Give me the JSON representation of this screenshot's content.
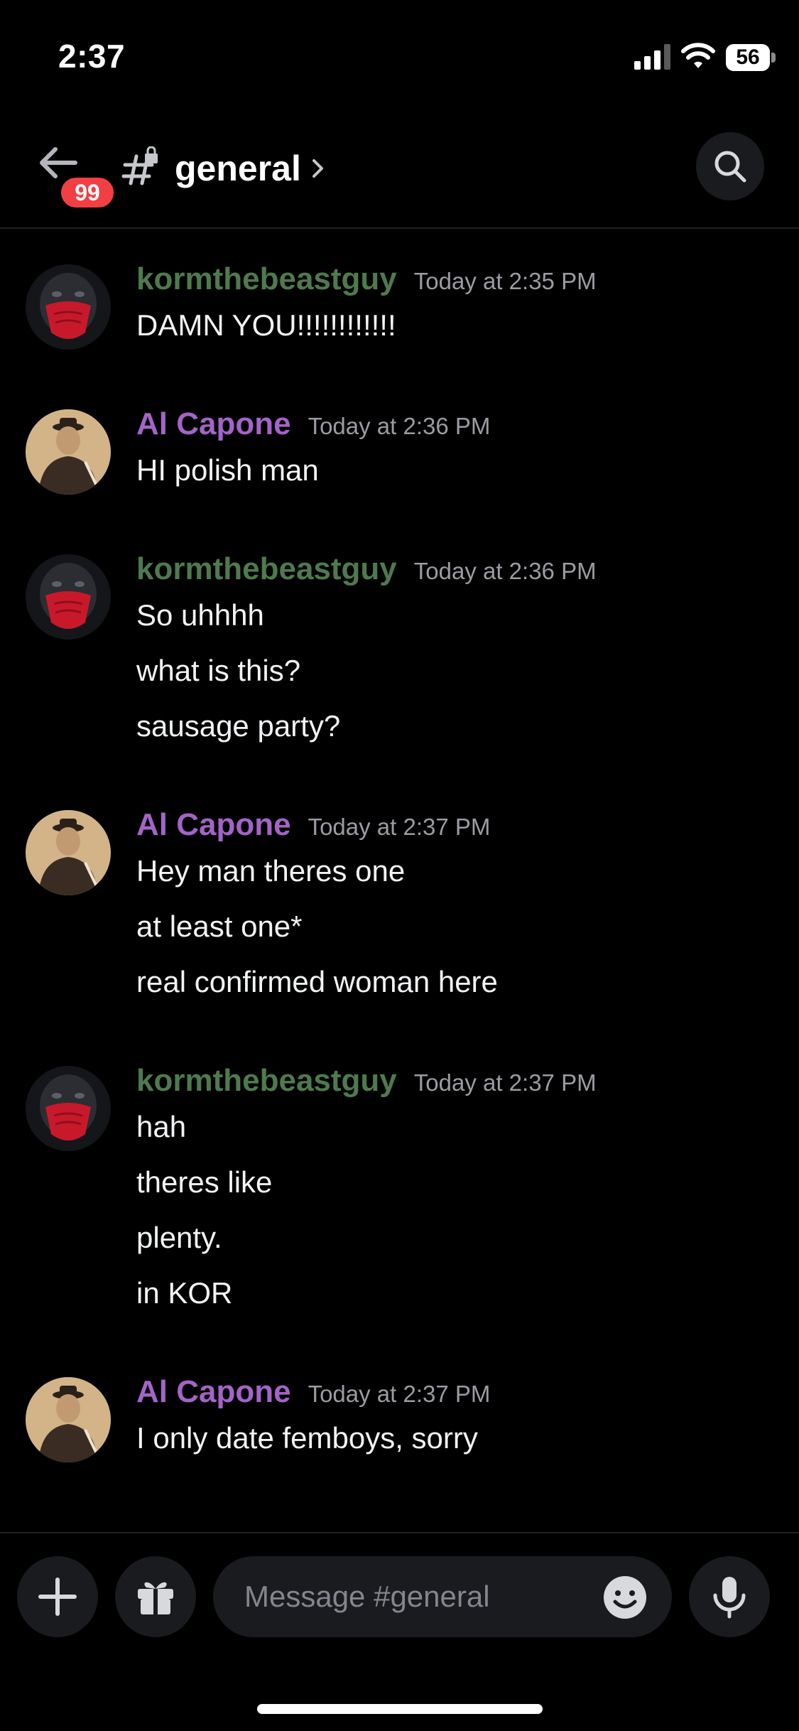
{
  "status_bar": {
    "time": "2:37",
    "battery": "56"
  },
  "header": {
    "unread_badge": "99",
    "channel_name": "general"
  },
  "messages": [
    {
      "author": "kormthebeastguy",
      "author_color": "#4e7a4d",
      "timestamp": "Today at 2:35 PM",
      "lines": [
        "DAMN YOU!!!!!!!!!!!!"
      ]
    },
    {
      "author": "Al Capone",
      "author_color": "#a364c7",
      "timestamp": "Today at 2:36 PM",
      "lines": [
        "HI polish man"
      ]
    },
    {
      "author": "kormthebeastguy",
      "author_color": "#4e7a4d",
      "timestamp": "Today at 2:36 PM",
      "lines": [
        "So uhhhh",
        "what is this?",
        "sausage party?"
      ]
    },
    {
      "author": "Al Capone",
      "author_color": "#a364c7",
      "timestamp": "Today at 2:37 PM",
      "lines": [
        "Hey man theres one",
        "at least one*",
        "real confirmed woman here"
      ]
    },
    {
      "author": "kormthebeastguy",
      "author_color": "#4e7a4d",
      "timestamp": "Today at 2:37 PM",
      "lines": [
        "hah",
        "theres like",
        "plenty.",
        "in KOR"
      ]
    },
    {
      "author": "Al Capone",
      "author_color": "#a364c7",
      "timestamp": "Today at 2:37 PM",
      "lines": [
        "I only date femboys, sorry"
      ]
    }
  ],
  "composer": {
    "placeholder": "Message #general"
  },
  "icons": {
    "back": "arrow-left-icon",
    "channel": "hash-lock-icon",
    "chevron": "chevron-right-icon",
    "search": "search-icon",
    "add": "plus-icon",
    "gift": "gift-icon",
    "emoji": "emoji-icon",
    "mic": "microphone-icon"
  },
  "colors": {
    "background": "#000000",
    "badge": "#f23f43",
    "surface": "#1a1b1e"
  }
}
